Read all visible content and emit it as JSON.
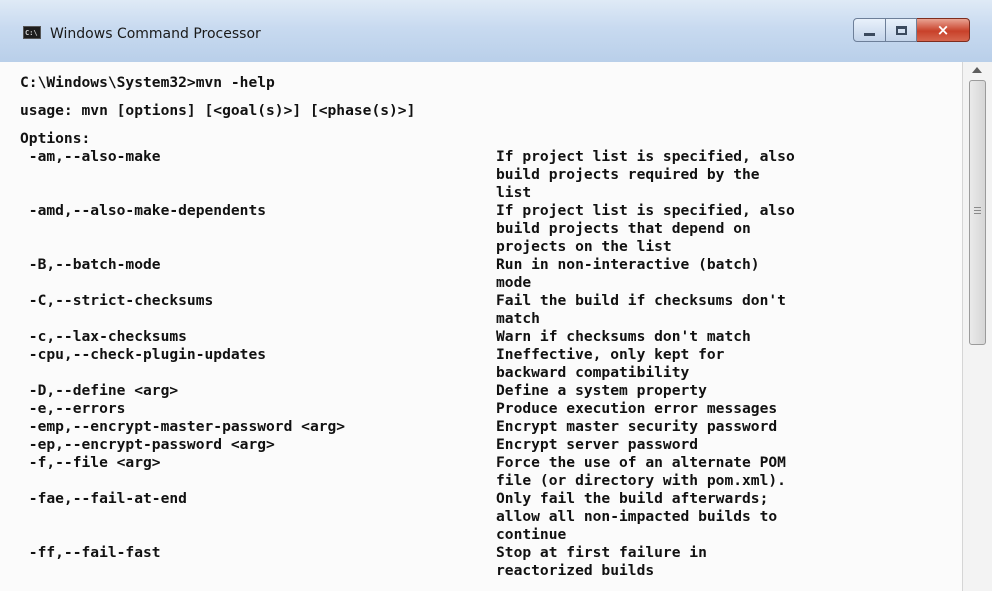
{
  "window": {
    "title": "Windows Command Processor",
    "icon": "cmd-console-icon",
    "icon_text": "C:\\",
    "controls": {
      "minimize": "minimize-icon",
      "maximize": "maximize-icon",
      "close": "×"
    }
  },
  "console": {
    "prompt_line": "C:\\Windows\\System32>mvn -help",
    "usage_line": "usage: mvn [options] [<goal(s)>] [<phase(s)>]",
    "options_header": "Options:",
    "options": [
      {
        "flag": " -am,--also-make",
        "description": [
          "If project list is specified, also",
          "build projects required by the",
          "list"
        ]
      },
      {
        "flag": " -amd,--also-make-dependents",
        "description": [
          "If project list is specified, also",
          "build projects that depend on",
          "projects on the list"
        ]
      },
      {
        "flag": " -B,--batch-mode",
        "description": [
          "Run in non-interactive (batch)",
          "mode"
        ]
      },
      {
        "flag": " -C,--strict-checksums",
        "description": [
          "Fail the build if checksums don't",
          "match"
        ]
      },
      {
        "flag": " -c,--lax-checksums",
        "description": [
          "Warn if checksums don't match"
        ]
      },
      {
        "flag": " -cpu,--check-plugin-updates",
        "description": [
          "Ineffective, only kept for",
          "backward compatibility"
        ]
      },
      {
        "flag": " -D,--define <arg>",
        "description": [
          "Define a system property"
        ]
      },
      {
        "flag": " -e,--errors",
        "description": [
          "Produce execution error messages"
        ]
      },
      {
        "flag": " -emp,--encrypt-master-password <arg>",
        "description": [
          "Encrypt master security password"
        ]
      },
      {
        "flag": " -ep,--encrypt-password <arg>",
        "description": [
          "Encrypt server password"
        ]
      },
      {
        "flag": " -f,--file <arg>",
        "description": [
          "Force the use of an alternate POM",
          "file (or directory with pom.xml)."
        ]
      },
      {
        "flag": " -fae,--fail-at-end",
        "description": [
          "Only fail the build afterwards;",
          "allow all non-impacted builds to",
          "continue"
        ]
      },
      {
        "flag": " -ff,--fail-fast",
        "description": [
          "Stop at first failure in",
          "reactorized builds"
        ]
      }
    ]
  },
  "scrollbar": {
    "position": 0.0,
    "up_icon": "scroll-up-arrow-icon",
    "grip_icon": "scroll-grip-icon"
  }
}
